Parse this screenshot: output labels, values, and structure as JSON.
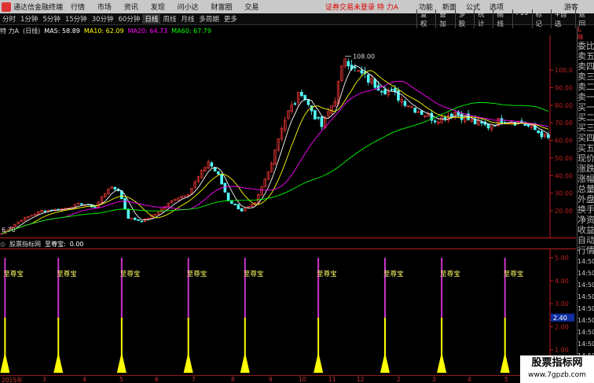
{
  "app": {
    "name": "通达信金融终端",
    "menu": [
      "行情",
      "市场",
      "资讯",
      "发现",
      "问小达",
      "财富圈",
      "交易"
    ],
    "notice": "证券交易未登录 特 力A",
    "right_menu": [
      "功能",
      "新面",
      "公式",
      "选项"
    ],
    "guest": "游客"
  },
  "toolbar": {
    "periods": [
      "分时",
      "1分钟",
      "5分钟",
      "15分钟",
      "30分钟",
      "60分钟",
      "日线",
      "周线",
      "月线",
      "多周期",
      "更多"
    ],
    "active_period": "日线",
    "right_buttons": [
      "复权",
      "叠加",
      "多股",
      "统计",
      "画线",
      "F10",
      "标记",
      "+自选",
      "返回"
    ]
  },
  "infoline": {
    "stock": "特 力A",
    "period": "(日线)",
    "ma5": "MA5: 58.89",
    "ma10": "MA10: 62.09",
    "ma20": "MA20: 64.73",
    "ma60": "MA60: 67.79"
  },
  "colors": {
    "ma5": "#ffffff",
    "ma10": "#ffff00",
    "ma20": "#ff00ff",
    "ma60": "#00ff00",
    "up": "#ff3c3c",
    "down": "#54ffff",
    "axis": "#c02020",
    "signal_top": "#cc33cc",
    "signal_bottom": "#ffff00"
  },
  "chart_data": [
    {
      "type": "candlestick",
      "title": "特 力A (日线)",
      "y_ticks": [
        "100.0",
        "90.00",
        "80.00",
        "70.00",
        "60.00",
        "50.00",
        "40.00",
        "30.00",
        "20.00"
      ],
      "ylim": [
        7,
        118
      ],
      "high_label": "108.00",
      "low_label": "6.70",
      "x_labels": [
        "2015年",
        "3",
        "4",
        "5",
        "6",
        "7",
        "8",
        "9",
        "10",
        "11",
        "12",
        "2",
        "3",
        "4",
        "5"
      ],
      "price_path": [
        [
          0,
          7
        ],
        [
          6,
          15
        ],
        [
          12,
          20
        ],
        [
          18,
          21
        ],
        [
          24,
          24
        ],
        [
          28,
          22
        ],
        [
          32,
          33
        ],
        [
          35,
          32
        ],
        [
          38,
          16
        ],
        [
          42,
          14
        ],
        [
          46,
          18
        ],
        [
          52,
          27
        ],
        [
          56,
          30
        ],
        [
          62,
          48
        ],
        [
          65,
          40
        ],
        [
          68,
          26
        ],
        [
          72,
          20
        ],
        [
          76,
          24
        ],
        [
          80,
          42
        ],
        [
          84,
          68
        ],
        [
          86,
          76
        ],
        [
          90,
          88
        ],
        [
          92,
          80
        ],
        [
          96,
          68
        ],
        [
          100,
          84
        ],
        [
          103,
          108
        ],
        [
          106,
          100
        ],
        [
          112,
          92
        ],
        [
          118,
          86
        ],
        [
          124,
          78
        ],
        [
          130,
          72
        ],
        [
          136,
          76
        ],
        [
          142,
          70
        ],
        [
          146,
          68
        ],
        [
          150,
          72
        ],
        [
          156,
          70
        ],
        [
          160,
          66
        ],
        [
          164,
          61
        ]
      ]
    },
    {
      "type": "bar",
      "title": "至尊宝",
      "y_ticks": [
        "5.00",
        "4.00",
        "3.00",
        "2.00",
        "1.00"
      ],
      "ylim": [
        0,
        5.4
      ],
      "current_value": "2.40",
      "signal_positions": [
        1,
        17,
        36,
        56,
        73,
        95,
        115,
        132,
        151
      ],
      "signal_label": "至尊宝"
    }
  ],
  "indicator": {
    "name": "股票指标网",
    "label": "至尊宝:",
    "value": "0.00"
  },
  "right_column": {
    "badge": "L",
    "red_small": "融",
    "items": [
      "委比",
      "卖五",
      "卖四",
      "卖三",
      "卖二",
      "卖一",
      "买一",
      "买二",
      "买三",
      "买四",
      "买五",
      "现价",
      "涨跌",
      "涨幅",
      "总量",
      "外盘",
      "换手",
      "净资",
      "收益",
      "自动",
      "行情",
      "14:50",
      "14:50",
      "14:50",
      "14:50",
      "14:50",
      "14:50",
      "14:50",
      "14:50",
      "14:50",
      "14:50"
    ]
  },
  "watermark": {
    "text": "股票指标网",
    "url": "www.7gpzb.com"
  }
}
